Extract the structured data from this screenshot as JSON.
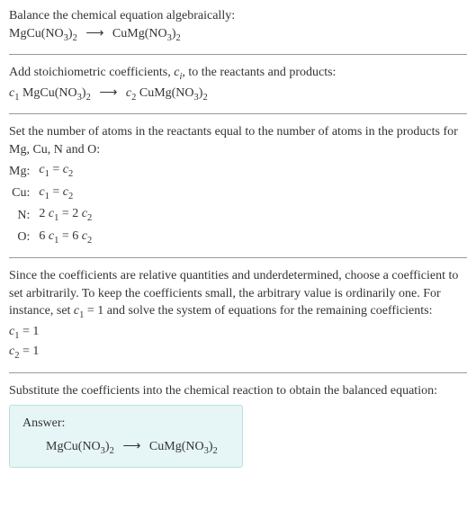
{
  "intro": {
    "line1": "Balance the chemical equation algebraically:",
    "reactant": "MgCu(NO",
    "reactant_sub1": "3",
    "reactant_paren": ")",
    "reactant_sub2": "2",
    "arrow": "⟶",
    "product": "CuMg(NO",
    "product_sub1": "3",
    "product_paren": ")",
    "product_sub2": "2"
  },
  "stoich": {
    "line1_a": "Add stoichiometric coefficients, ",
    "ci": "c",
    "ci_sub": "i",
    "line1_b": ", to the reactants and products:",
    "c1": "c",
    "c1_sub": "1",
    "sp1": " MgCu(NO",
    "sub1a": "3",
    "paren1": ")",
    "sub1b": "2",
    "arrow": "⟶",
    "c2": "c",
    "c2_sub": "2",
    "sp2": " CuMg(NO",
    "sub2a": "3",
    "paren2": ")",
    "sub2b": "2"
  },
  "atoms": {
    "text": "Set the number of atoms in the reactants equal to the number of atoms in the products for Mg, Cu, N and O:",
    "rows": [
      {
        "label": "Mg:",
        "lhs_coef": "",
        "lhs_c": "c",
        "lhs_sub": "1",
        "eq": " = ",
        "rhs_coef": "",
        "rhs_c": "c",
        "rhs_sub": "2"
      },
      {
        "label": "Cu:",
        "lhs_coef": "",
        "lhs_c": "c",
        "lhs_sub": "1",
        "eq": " = ",
        "rhs_coef": "",
        "rhs_c": "c",
        "rhs_sub": "2"
      },
      {
        "label": "N:",
        "lhs_coef": "2 ",
        "lhs_c": "c",
        "lhs_sub": "1",
        "eq": " = ",
        "rhs_coef": "2 ",
        "rhs_c": "c",
        "rhs_sub": "2"
      },
      {
        "label": "O:",
        "lhs_coef": "6 ",
        "lhs_c": "c",
        "lhs_sub": "1",
        "eq": " = ",
        "rhs_coef": "6 ",
        "rhs_c": "c",
        "rhs_sub": "2"
      }
    ]
  },
  "solve": {
    "text_a": "Since the coefficients are relative quantities and underdetermined, choose a coefficient to set arbitrarily. To keep the coefficients small, the arbitrary value is ordinarily one. For instance, set ",
    "c1": "c",
    "c1_sub": "1",
    "text_b": " = 1 and solve the system of equations for the remaining coefficients:",
    "eq1_c": "c",
    "eq1_sub": "1",
    "eq1_rhs": " = 1",
    "eq2_c": "c",
    "eq2_sub": "2",
    "eq2_rhs": " = 1"
  },
  "subst": {
    "text": "Substitute the coefficients into the chemical reaction to obtain the balanced equation:"
  },
  "answer": {
    "label": "Answer:",
    "reactant": "MgCu(NO",
    "r_sub1": "3",
    "r_paren": ")",
    "r_sub2": "2",
    "arrow": "⟶",
    "product": "CuMg(NO",
    "p_sub1": "3",
    "p_paren": ")",
    "p_sub2": "2"
  }
}
